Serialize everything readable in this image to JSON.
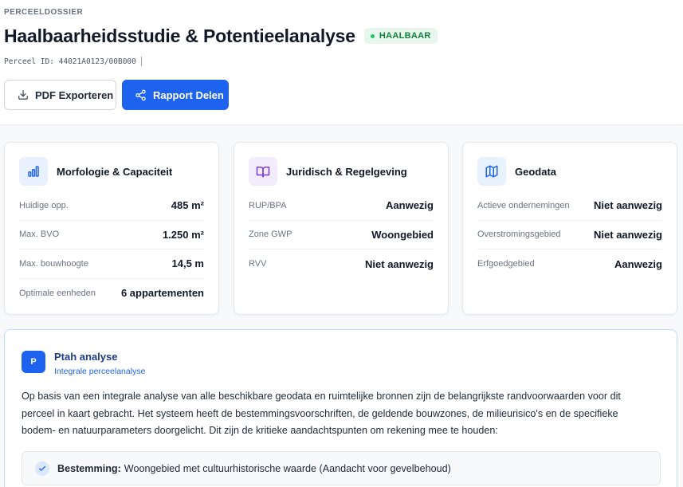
{
  "header": {
    "eyebrow": "PERCEELDOSSIER",
    "title": "Haalbaarheidsstudie & Potentieelanalyse",
    "status_badge": "HAALBAAR",
    "parcel_id": "Perceel ID: 44021A0123/00B000",
    "export_button": "PDF Exporteren",
    "share_button": "Rapport Delen"
  },
  "cards": [
    {
      "title": "Morfologie & Capaciteit",
      "icon": "bar-chart-icon",
      "rows": [
        {
          "label": "Huidige opp.",
          "value": "485 m²"
        },
        {
          "label": "Max. BVO",
          "value": "1.250 m²"
        },
        {
          "label": "Max. bouwhoogte",
          "value": "14,5 m"
        },
        {
          "label": "Optimale eenheden",
          "value": "6 appartementen"
        }
      ]
    },
    {
      "title": "Juridisch & Regelgeving",
      "icon": "book-icon",
      "rows": [
        {
          "label": "RUP/BPA",
          "value": "Aanwezig"
        },
        {
          "label": "Zone GWP",
          "value": "Woongebied"
        },
        {
          "label": "RVV",
          "value": "Niet aanwezig"
        }
      ]
    },
    {
      "title": "Geodata",
      "icon": "map-icon",
      "rows": [
        {
          "label": "Actieve ondernemingen",
          "value": "Niet aanwezig"
        },
        {
          "label": "Overstromingsgebied",
          "value": "Niet aanwezig"
        },
        {
          "label": "Erfgoedgebied",
          "value": "Aanwezig"
        }
      ]
    }
  ],
  "analysis": {
    "badge": "P",
    "title": "Ptah analyse",
    "subtitle": "Integrale perceelanalyse",
    "body": "Op basis van een integrale analyse van alle beschikbare geodata en ruimtelijke bronnen zijn de belangrijkste randvoorwaarden voor dit perceel in kaart gebracht. Het systeem heeft de bestemmingsvoorschriften, de geldende bouwzones, de milieurisico's en de specifieke bodem- en natuurparameters doorgelicht. Dit zijn de kritieke aandachtspunten om rekening mee te houden:",
    "points": [
      {
        "label": "Bestemming:",
        "text": "Woongebied met cultuurhistorische waarde (Aandacht voor gevelbehoud)"
      }
    ]
  },
  "colors": {
    "primary": "#1d63f0",
    "success": "#15803d",
    "card1_icon_bg": "#eaf1fe",
    "card2_icon_bg": "#f3ecfd",
    "card3_icon_bg": "#e8f2fd"
  }
}
